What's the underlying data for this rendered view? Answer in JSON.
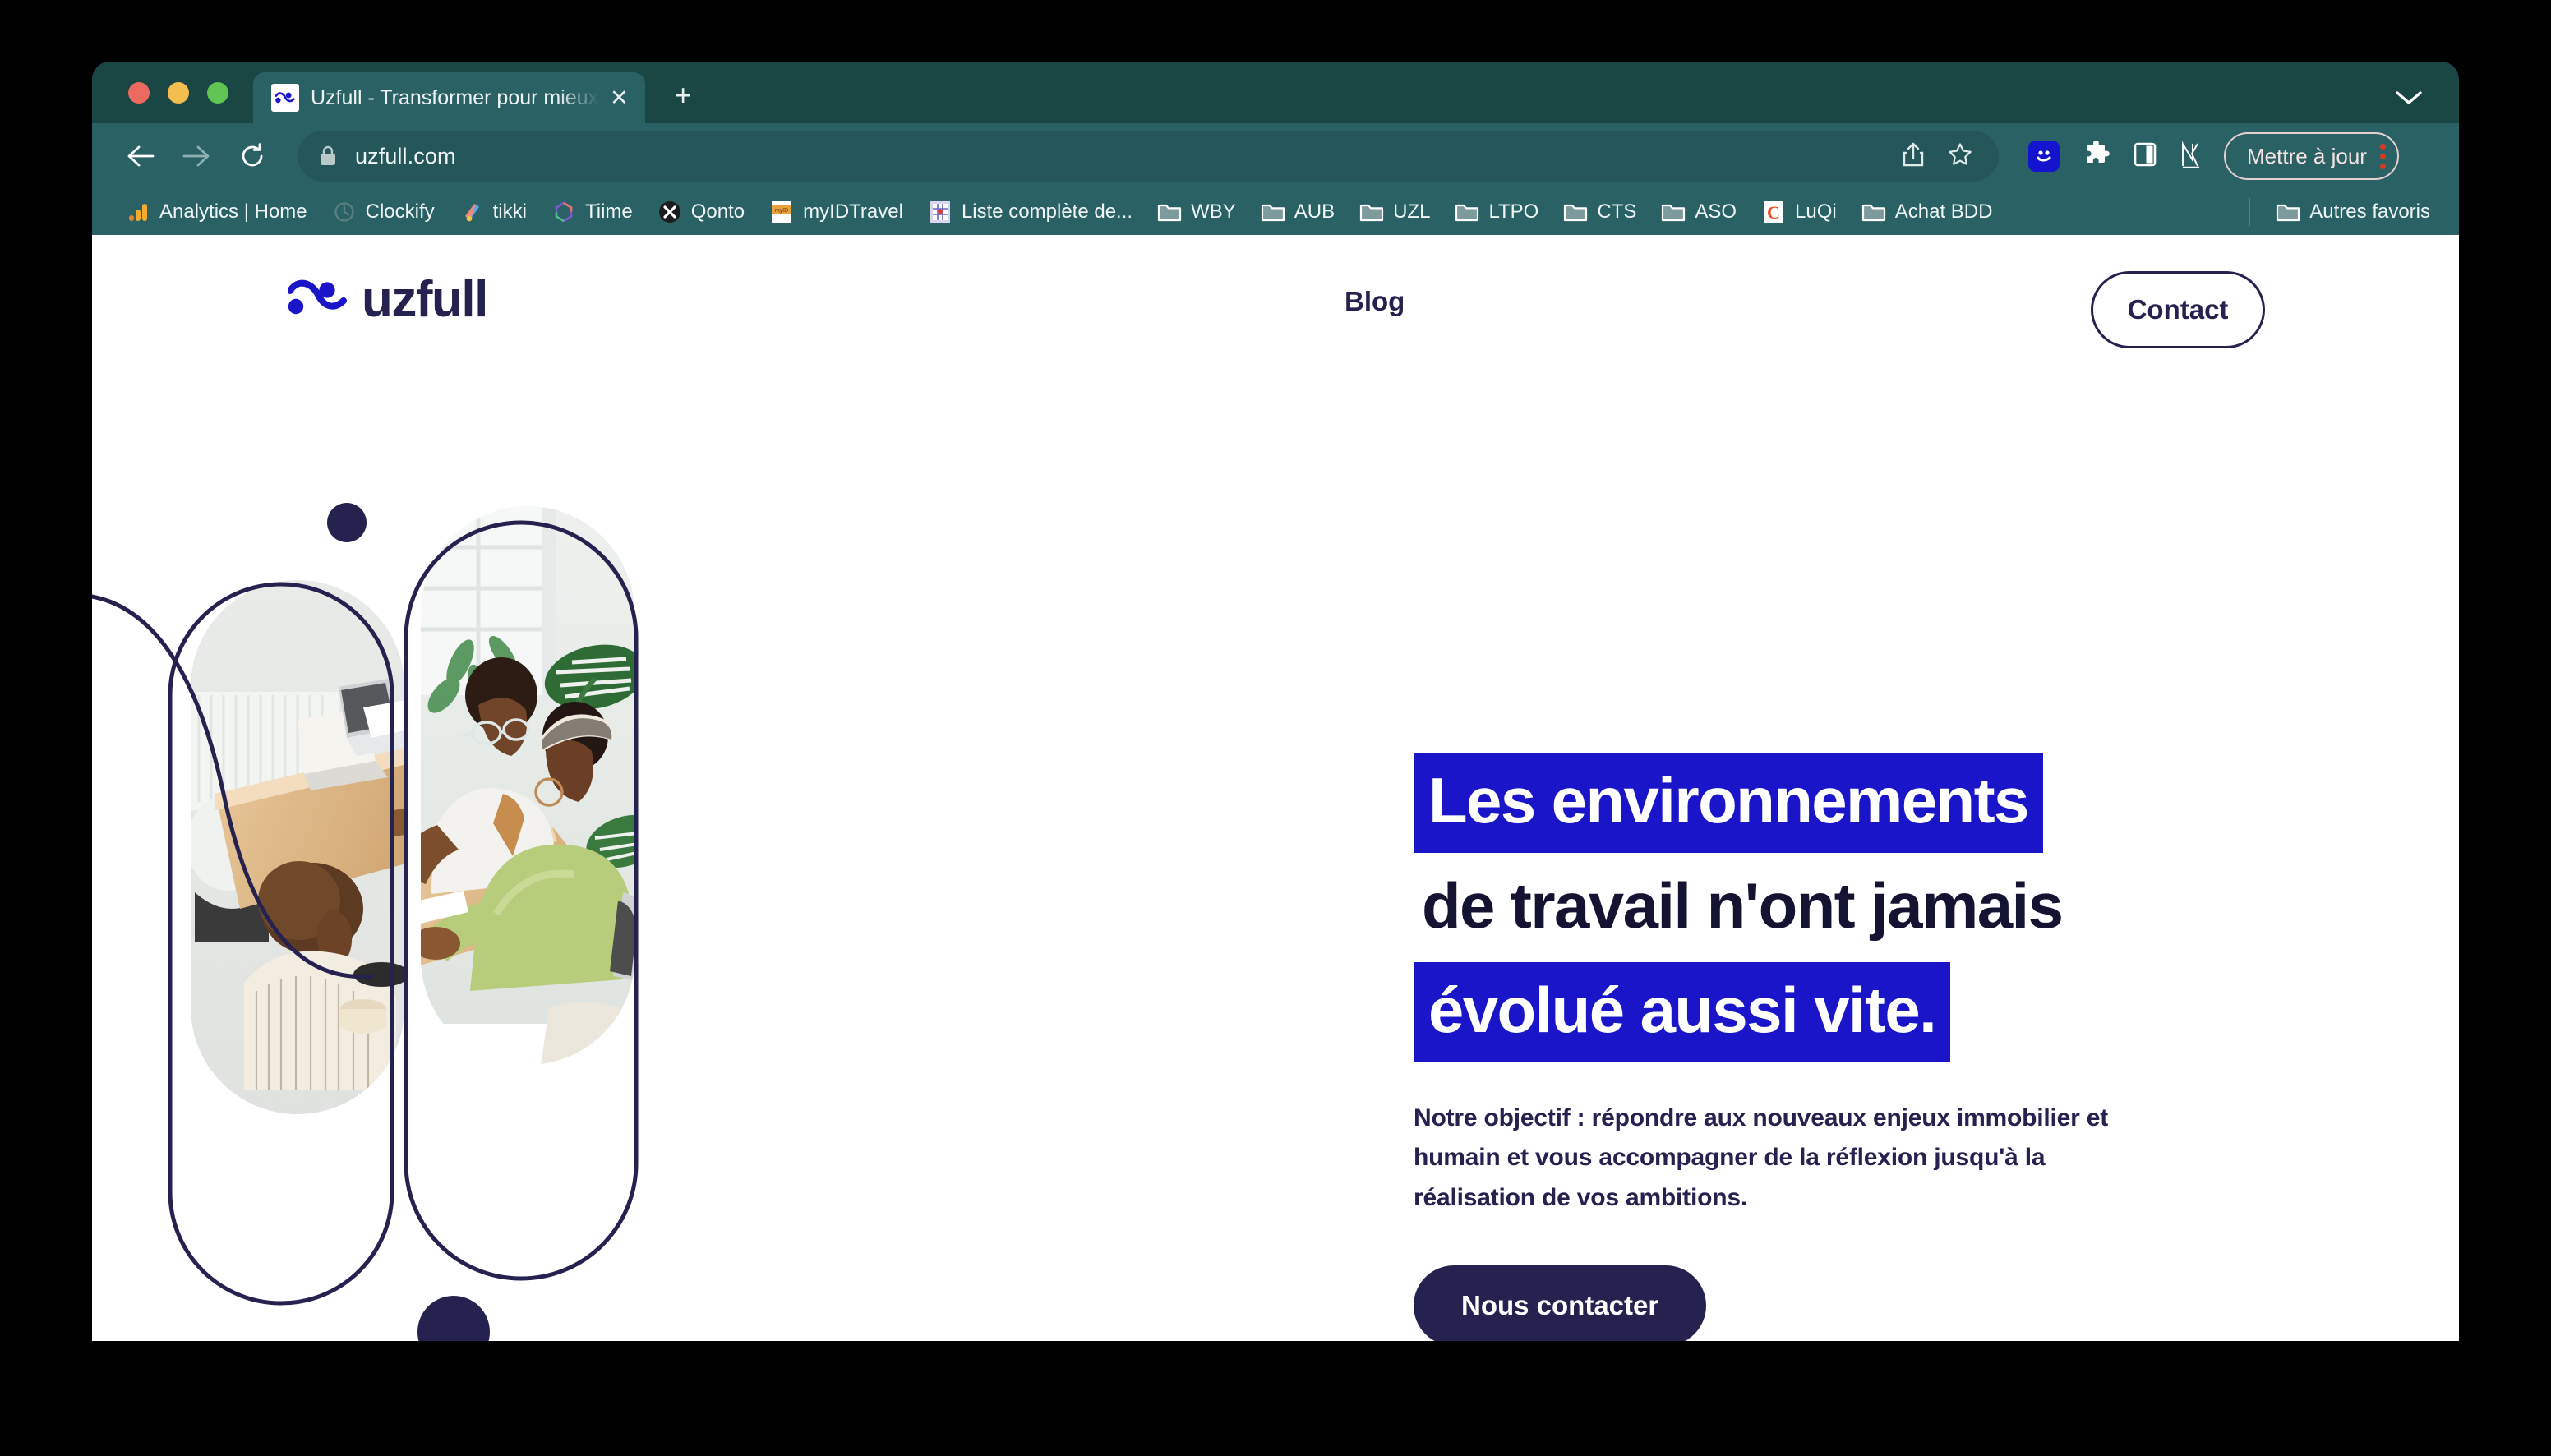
{
  "browser": {
    "tab": {
      "title": "Uzfull - Transformer pour mieux",
      "favicon_name": "uzfull-favicon",
      "close_label": "✕"
    },
    "new_tab_label": "+",
    "window_chevron_name": "chevron-down-icon",
    "toolbar": {
      "back_label": "←",
      "forward_label": "→",
      "reload_label": "⟳",
      "lock_name": "lock-icon",
      "url": "uzfull.com",
      "share_name": "share-icon",
      "bookmark_star_name": "star-icon",
      "smiley_ext_name": "smiley-extension-icon",
      "puzzle_ext_name": "puzzle-extension-icon",
      "sidepanel_name": "side-panel-icon",
      "nk_ext_name": "nk-extension-icon",
      "update_label": "Mettre à jour",
      "menu_name": "kebab-menu-icon"
    },
    "bookmarks": [
      {
        "label": "Analytics | Home",
        "icon": "analytics-bars-icon"
      },
      {
        "label": "Clockify",
        "icon": "clockify-icon"
      },
      {
        "label": "tikki",
        "icon": "tikki-icon"
      },
      {
        "label": "Tiime",
        "icon": "tiime-icon"
      },
      {
        "label": "Qonto",
        "icon": "qonto-icon"
      },
      {
        "label": "myIDTravel",
        "icon": "myidtravel-icon"
      },
      {
        "label": "Liste complète de...",
        "icon": "spreadsheet-icon"
      },
      {
        "label": "WBY",
        "icon": "folder-icon"
      },
      {
        "label": "AUB",
        "icon": "folder-icon"
      },
      {
        "label": "UZL",
        "icon": "folder-icon"
      },
      {
        "label": "LTPO",
        "icon": "folder-icon"
      },
      {
        "label": "CTS",
        "icon": "folder-icon"
      },
      {
        "label": "ASO",
        "icon": "folder-icon"
      },
      {
        "label": "LuQi",
        "icon": "luqi-icon"
      },
      {
        "label": "Achat BDD",
        "icon": "folder-icon"
      }
    ],
    "other_bookmarks": {
      "label": "Autres favoris",
      "icon": "folder-icon"
    }
  },
  "site": {
    "logo_word": "uzfull",
    "logo_mark_name": "uzfull-wave-mark",
    "nav": {
      "blog": "Blog",
      "contact": "Contact"
    },
    "hero": {
      "headline_line1": "Les environnements",
      "headline_line2": "de travail n'ont jamais",
      "headline_line3": "évolué aussi vite.",
      "lede": "Notre objectif : répondre aux nouveaux enjeux immobilier et humain et vous accompagner de la réflexion jusqu'à la réalisation de vos ambitions.",
      "cta": "Nous contacter"
    }
  },
  "colors": {
    "brand_navy": "#262250",
    "brand_blue": "#1a15c8",
    "chrome_tabstrip": "#1a4644",
    "chrome_toolbar": "#2a6165",
    "omnibox": "#25565a",
    "update_accent": "#d63a1e"
  }
}
